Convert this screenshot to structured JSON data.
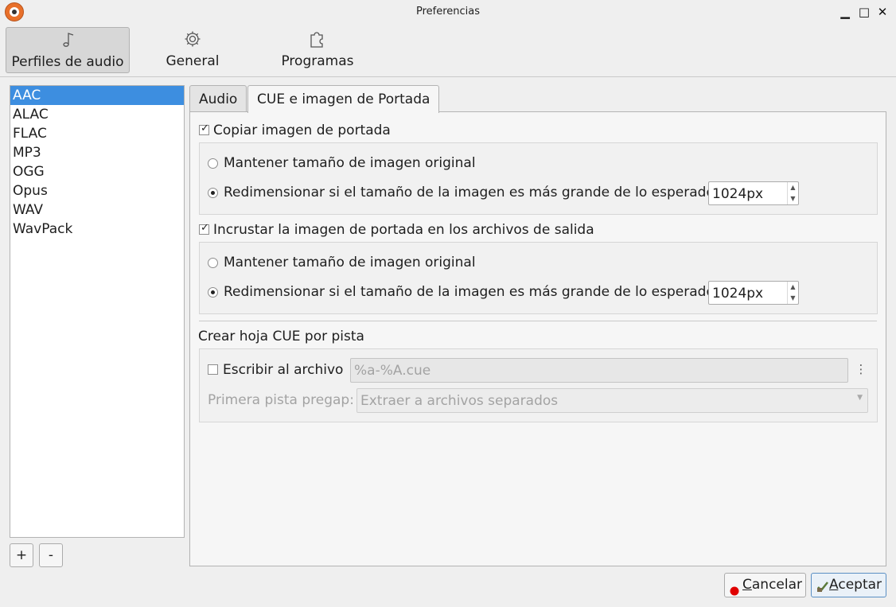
{
  "window": {
    "title": "Preferencias",
    "buttons": {
      "minimize": "▁",
      "maximize": "□",
      "close": "✕"
    }
  },
  "toolbar": {
    "categories": [
      {
        "label": "Perfiles de audio",
        "icon": "music-note-icon",
        "active": true
      },
      {
        "label": "General",
        "icon": "gear-icon",
        "active": false
      },
      {
        "label": "Programas",
        "icon": "puzzle-icon",
        "active": false
      }
    ]
  },
  "profiles": {
    "items": [
      "AAC",
      "ALAC",
      "FLAC",
      "MP3",
      "OGG",
      "Opus",
      "WAV",
      "WavPack"
    ],
    "selected": "AAC",
    "add_label": "+",
    "remove_label": "-"
  },
  "tabs": [
    {
      "label": "Audio",
      "active": false
    },
    {
      "label": "CUE e imagen de Portada",
      "active": true
    }
  ],
  "cover_copy": {
    "checkbox_label": "Copiar imagen de portada",
    "checked": true,
    "keep_label": "Mantener tamaño de imagen original",
    "resize_label": "Redimensionar si el tamaño de la imagen es más grande de lo esperado",
    "resize_selected": true,
    "size_value": "1024px"
  },
  "cover_embed": {
    "checkbox_label": "Incrustar la imagen de portada en los archivos de salida",
    "checked": true,
    "keep_label": "Mantener tamaño de imagen original",
    "resize_label": "Redimensionar si el tamaño de la imagen es más grande de lo esperado",
    "resize_selected": true,
    "size_value": "1024px"
  },
  "cue": {
    "section_title": "Crear hoja CUE por pista",
    "write_label": "Escribir al archivo",
    "write_checked": false,
    "pattern_value": "%a-%A.cue",
    "pregap_label": "Primera pista pregap:",
    "pregap_value": "Extraer a archivos separados"
  },
  "dialog": {
    "cancel_label": "ancelar",
    "cancel_mnemonic": "C",
    "accept_label": "ceptar",
    "accept_mnemonic": "A"
  },
  "colors": {
    "selection": "#3d8ee0",
    "cancel_icon": "#e00000",
    "accept_icon": "#5a7a3a"
  }
}
